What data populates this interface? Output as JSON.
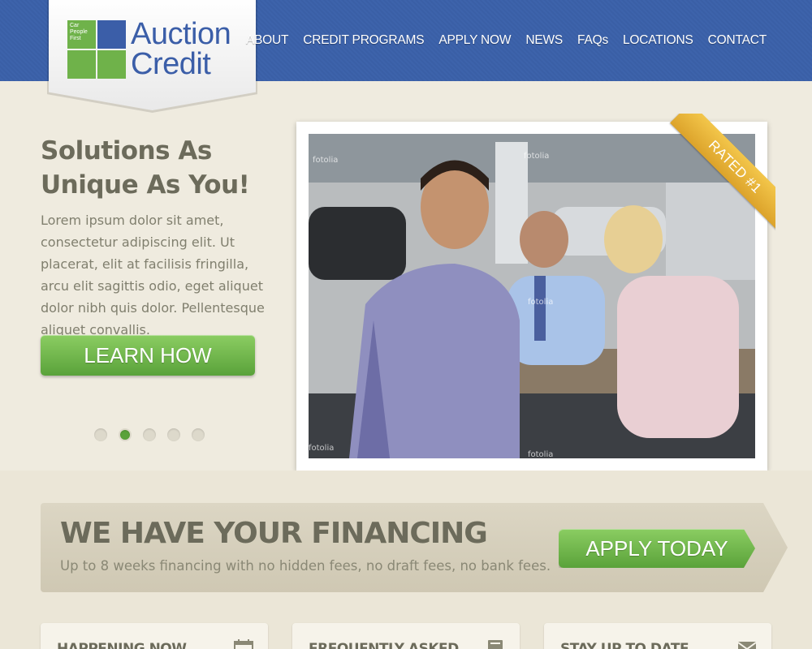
{
  "brand": {
    "name_line1": "Auction",
    "name_line2": "Credit",
    "tagline_line1": "Car",
    "tagline_line2": "People",
    "tagline_line3": "First",
    "primary_color": "#3b5ea8",
    "accent_color": "#6fb24a"
  },
  "nav": {
    "items": [
      {
        "label": "ABOUT"
      },
      {
        "label": "CREDIT PROGRAMS"
      },
      {
        "label": "APPLY NOW"
      },
      {
        "label": "NEWS"
      },
      {
        "label": "FAQs"
      },
      {
        "label": "LOCATIONS"
      },
      {
        "label": "CONTACT"
      }
    ]
  },
  "hero": {
    "title": "Solutions As Unique As You!",
    "body": "Lorem ipsum dolor sit amet, consectetur adipiscing elit. Ut placerat, elit at facilisis fringilla, arcu elit sagittis odio, eget aliquet dolor nibh quis dolor. Pellentesque aliquet convallis.",
    "button_label": "LEARN HOW",
    "slides_total": 5,
    "slide_active": 2,
    "ribbon_label": "RATED #1",
    "ribbon_color": "#e8b43a"
  },
  "financing": {
    "title": "WE HAVE YOUR FINANCING",
    "subtitle": "Up to 8 weeks financing with no hidden fees, no draft fees, no bank fees.",
    "button_label": "APPLY TODAY"
  },
  "cards": [
    {
      "title": "HAPPENING NOW",
      "icon": "calendar-icon"
    },
    {
      "title": "FREQUENTLY ASKED",
      "icon": "book-icon"
    },
    {
      "title": "STAY UP TO DATE",
      "icon": "envelope-icon"
    }
  ]
}
